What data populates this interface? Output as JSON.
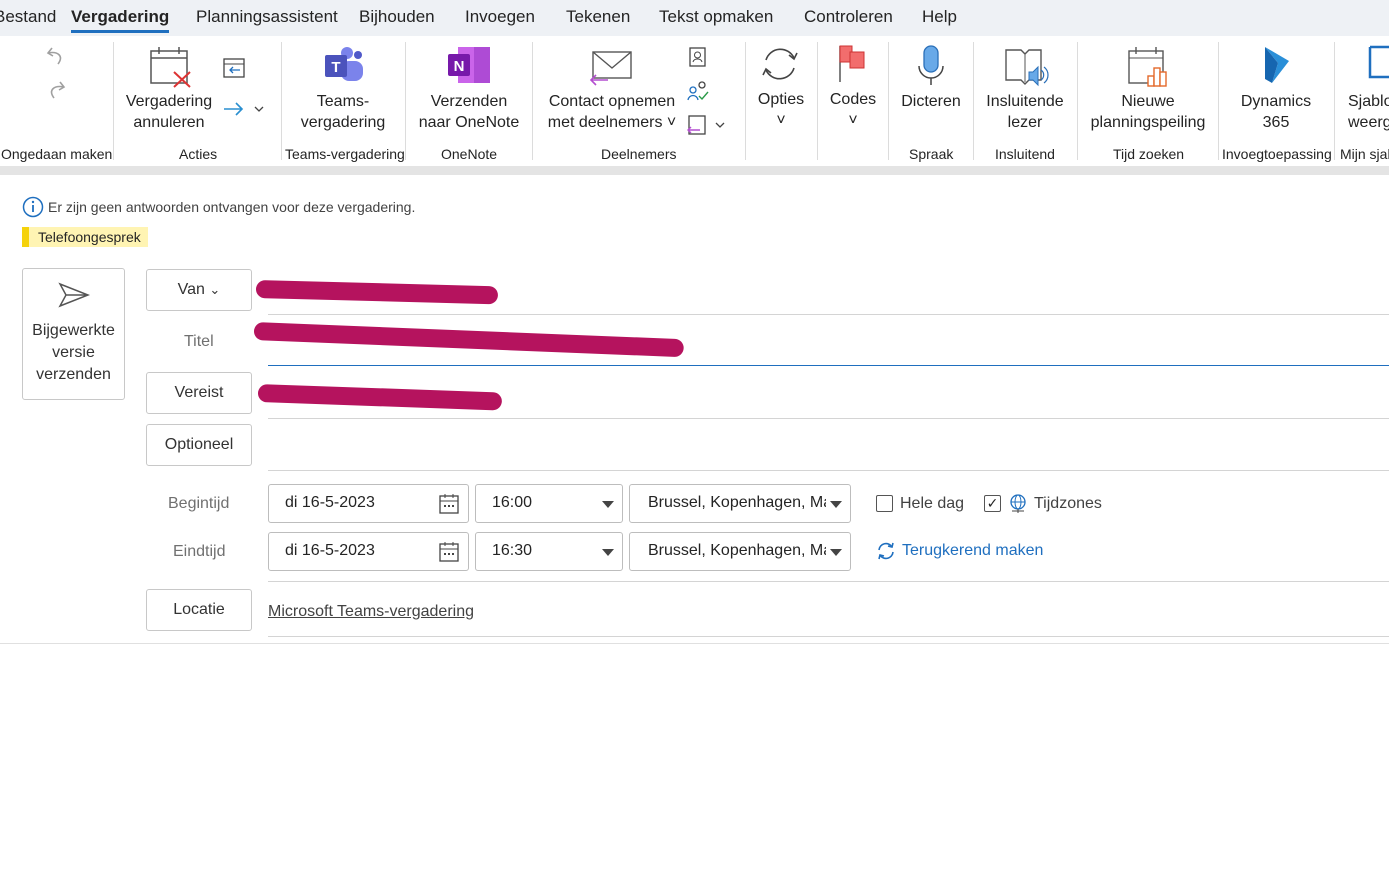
{
  "menu_tabs": [
    "Bestand",
    "Vergadering",
    "Planningsassistent",
    "Bijhouden",
    "Invoegen",
    "Tekenen",
    "Tekst opmaken",
    "Controleren",
    "Help"
  ],
  "active_tab": "Vergadering",
  "ribbon": {
    "groups": {
      "undo": "Ongedaan maken",
      "actions": "Acties",
      "teams": "Teams-vergadering",
      "onenote": "OneNote",
      "attendees": "Deelnemers",
      "speech": "Spraak",
      "immersive": "Insluitend",
      "findtime": "Tijd zoeken",
      "addin": "Invoegtoepassing",
      "templates": "Mijn sjal"
    },
    "buttons": {
      "cancel_1": "Vergadering",
      "cancel_2": "annuleren",
      "teams_1": "Teams-",
      "teams_2": "vergadering",
      "onenote_1": "Verzenden",
      "onenote_2": "naar OneNote",
      "contact_1": "Contact opnemen",
      "contact_2": "met deelnemers ˅",
      "options": "Opties",
      "codes": "Codes",
      "dictate": "Dicteren",
      "reader_1": "Insluitende",
      "reader_2": "lezer",
      "poll_1": "Nieuwe",
      "poll_2": "planningspeiling",
      "dyn_1": "Dynamics",
      "dyn_2": "365",
      "tpl_1": "Sjablo",
      "tpl_2": "weerg"
    }
  },
  "info_message": "Er zijn geen antwoorden ontvangen voor deze vergadering.",
  "category_tag": "Telefoongesprek",
  "colors": {
    "accent": "#1f6fbf",
    "category": "#fff4b3",
    "category_bar": "#f5d20b",
    "redaction": "#b5135e"
  },
  "form": {
    "send_button": [
      "Bijgewerkte",
      "versie",
      "verzenden"
    ],
    "from_label": "Van",
    "title_label": "Titel",
    "required_label": "Vereist",
    "optional_label": "Optioneel",
    "start_label": "Begintijd",
    "end_label": "Eindtijd",
    "start_date": "di 16-5-2023",
    "start_time": "16:00",
    "end_date": "di 16-5-2023",
    "end_time": "16:30",
    "timezone_start": "Brussel, Kopenhagen, Ma",
    "timezone_end": "Brussel, Kopenhagen, Ma",
    "all_day_label": "Hele dag",
    "all_day_checked": false,
    "timezones_label": "Tijdzones",
    "timezones_checked": true,
    "recurring_label": "Terugkerend maken",
    "location_label": "Locatie",
    "location_value": "Microsoft Teams-vergadering"
  }
}
